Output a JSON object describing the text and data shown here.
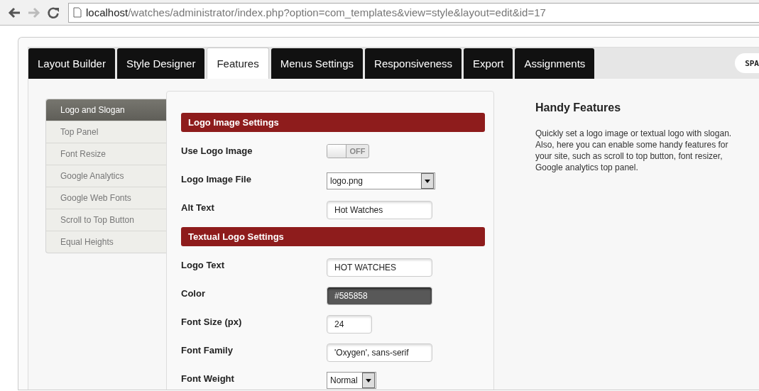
{
  "browser": {
    "url_host": "localhost",
    "url_path": "/watches/administrator/index.php?option=com_templates&view=style&layout=edit&id=17"
  },
  "tabs": [
    {
      "label": "Layout Builder",
      "selected": false
    },
    {
      "label": "Style Designer",
      "selected": false
    },
    {
      "label": "Features",
      "selected": true
    },
    {
      "label": "Menus Settings",
      "selected": false
    },
    {
      "label": "Responsiveness",
      "selected": false
    },
    {
      "label": "Export",
      "selected": false
    },
    {
      "label": "Assignments",
      "selected": false
    }
  ],
  "logo": {
    "text": "SPA"
  },
  "sidebar": {
    "items": [
      {
        "label": "Logo and Slogan",
        "selected": true
      },
      {
        "label": "Top Panel",
        "selected": false
      },
      {
        "label": "Font Resize",
        "selected": false
      },
      {
        "label": "Google Analytics",
        "selected": false
      },
      {
        "label": "Google Web Fonts",
        "selected": false
      },
      {
        "label": "Scroll to Top Button",
        "selected": false
      },
      {
        "label": "Equal Heights",
        "selected": false
      }
    ]
  },
  "sections": [
    {
      "title": "Logo Image Settings",
      "fields": [
        {
          "kind": "toggle",
          "label": "Use Logo Image",
          "on": false,
          "state_text": "OFF"
        },
        {
          "kind": "combo",
          "label": "Logo Image File",
          "value": "logo.png"
        },
        {
          "kind": "text",
          "label": "Alt Text",
          "value": "Hot Watches"
        }
      ]
    },
    {
      "title": "Textual Logo Settings",
      "fields": [
        {
          "kind": "text",
          "label": "Logo Text",
          "value": "HOT WATCHES"
        },
        {
          "kind": "color",
          "label": "Color",
          "value": "#585858"
        },
        {
          "kind": "number",
          "label": "Font Size (px)",
          "value": "24"
        },
        {
          "kind": "text",
          "label": "Font Family",
          "value": "'Oxygen', sans-serif"
        },
        {
          "kind": "select",
          "label": "Font Weight",
          "value": "Normal"
        }
      ]
    }
  ],
  "help": {
    "title": "Handy Features",
    "text": "Quickly set a logo image or textual logo with slogan. Also, here you can enable some handy features for your site, such as scroll to top button, font resizer, Google analytics top panel."
  }
}
